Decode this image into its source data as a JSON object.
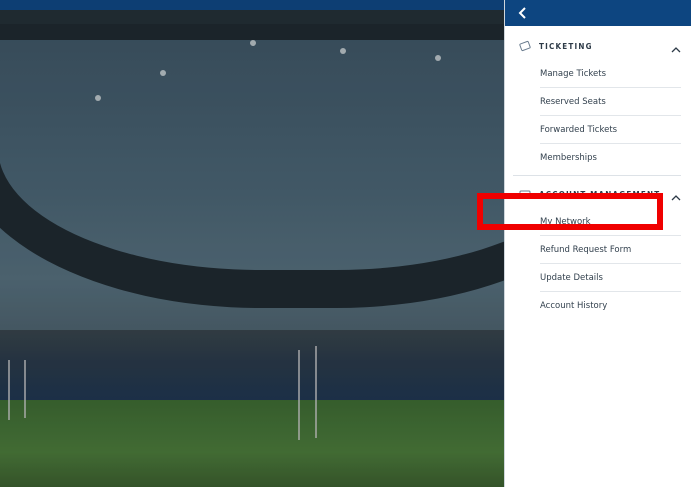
{
  "panel": {
    "back_icon": "chevron-left-icon",
    "sections": [
      {
        "title": "TICKETING",
        "icon": "ticket-icon",
        "items": [
          "Manage Tickets",
          "Reserved Seats",
          "Forwarded Tickets",
          "Memberships"
        ]
      },
      {
        "title": "ACCOUNT MANAGEMENT",
        "icon": "id-card-icon",
        "items": [
          "My Network",
          "Refund Request Form",
          "Update Details",
          "Account History"
        ]
      }
    ]
  },
  "highlight": {
    "color": "#f00000",
    "target": "My Network"
  },
  "colors": {
    "header": "#0d4580",
    "topbar": "#0d3e73",
    "panel_bg": "#ffffff"
  }
}
